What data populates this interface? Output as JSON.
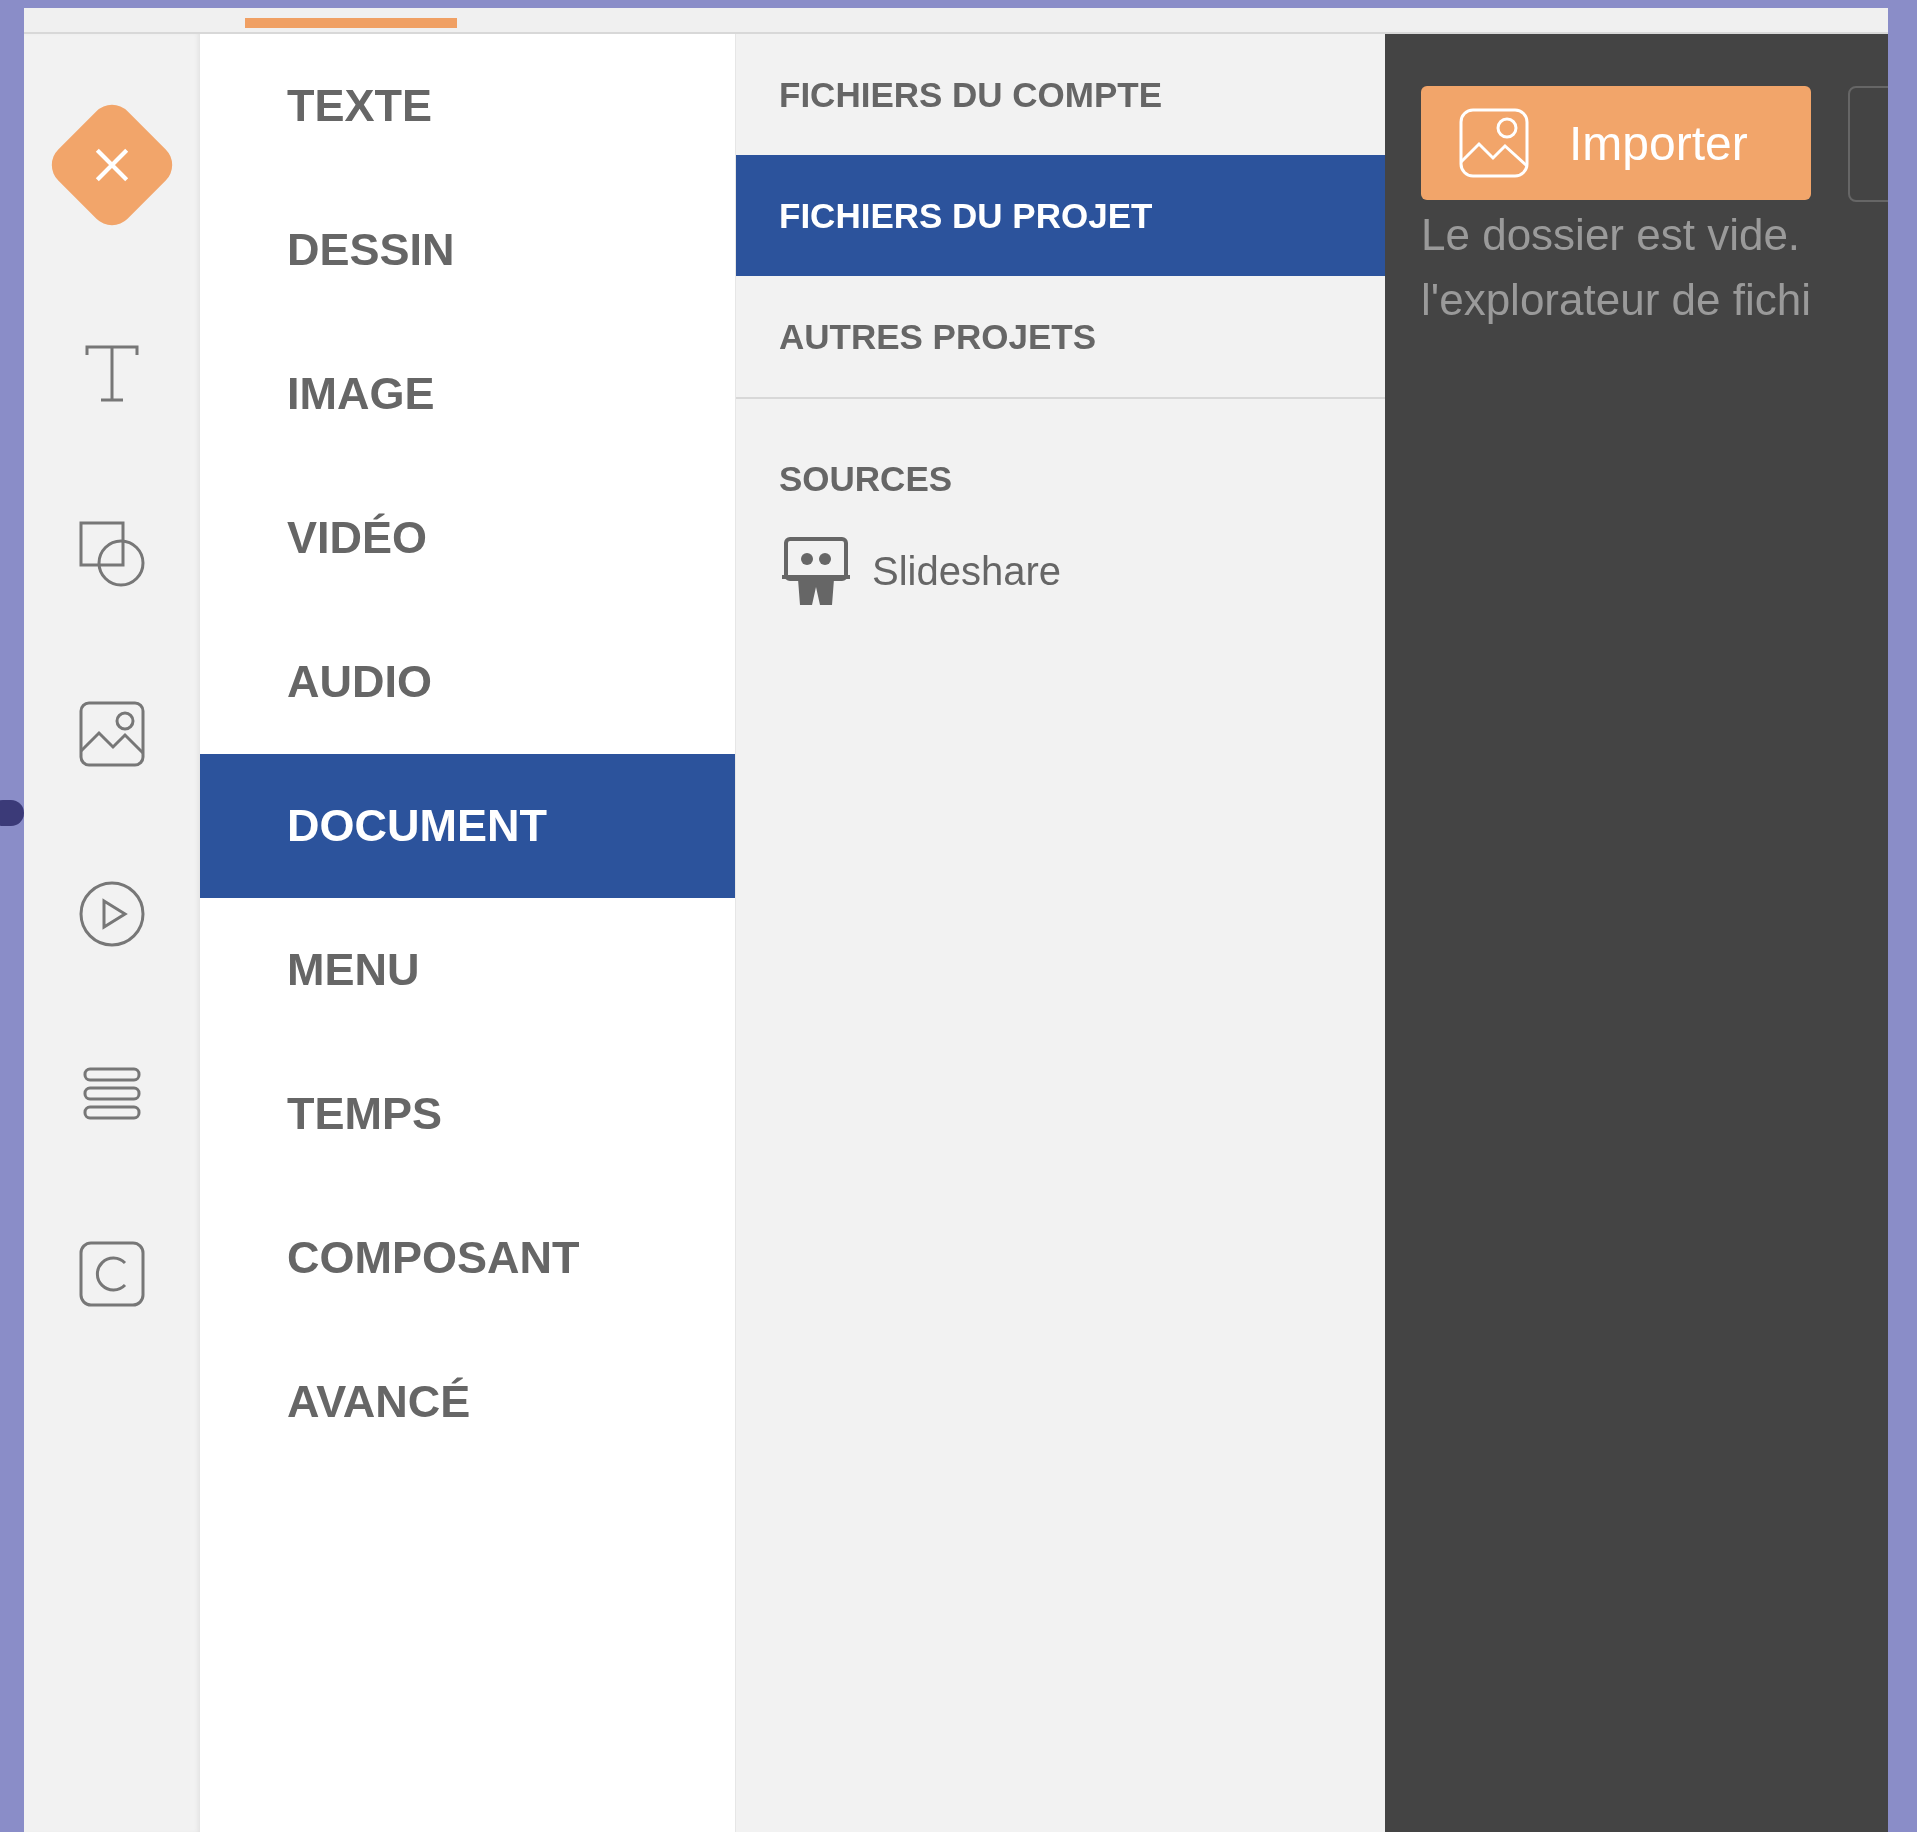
{
  "rail": [
    {
      "kind": "close"
    },
    {
      "kind": "text"
    },
    {
      "kind": "shapes"
    },
    {
      "kind": "image"
    },
    {
      "kind": "video"
    },
    {
      "kind": "menu"
    },
    {
      "kind": "component"
    }
  ],
  "categories": [
    {
      "label": "TEXTE",
      "selected": false
    },
    {
      "label": "DESSIN",
      "selected": false
    },
    {
      "label": "IMAGE",
      "selected": false
    },
    {
      "label": "VIDÉO",
      "selected": false
    },
    {
      "label": "AUDIO",
      "selected": false
    },
    {
      "label": "DOCUMENT",
      "selected": true
    },
    {
      "label": "MENU",
      "selected": false
    },
    {
      "label": "TEMPS",
      "selected": false
    },
    {
      "label": "COMPOSANT",
      "selected": false
    },
    {
      "label": "AVANCÉ",
      "selected": false
    }
  ],
  "file_tabs": [
    {
      "label": "FICHIERS DU COMPTE",
      "selected": false
    },
    {
      "label": "FICHIERS DU PROJET",
      "selected": true
    },
    {
      "label": "AUTRES PROJETS",
      "selected": false
    }
  ],
  "sources": {
    "title": "SOURCES",
    "items": [
      {
        "label": "Slideshare",
        "kind": "slideshare"
      }
    ]
  },
  "panel": {
    "import_button": "Importer",
    "message_lines": [
      "Le dossier est vide.",
      "l'explorateur de fichi"
    ]
  }
}
